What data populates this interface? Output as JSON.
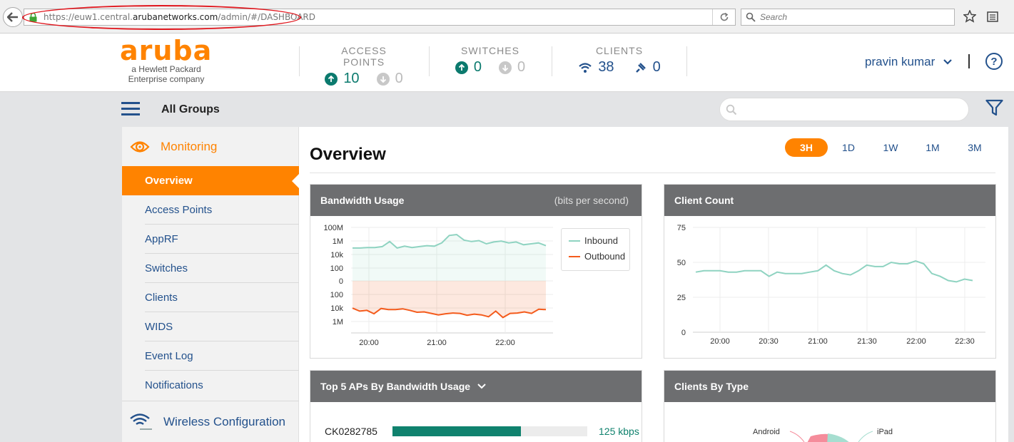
{
  "browser": {
    "url_prefix": "https://euw1.central.",
    "url_domain": "arubanetworks.com",
    "url_path": "/admin/#/DASHBOARD",
    "search_placeholder": "Search"
  },
  "header": {
    "logo_text": "aruba",
    "logo_sub": "a Hewlett Packard Enterprise company",
    "stats": [
      {
        "label": "ACCESS POINTS",
        "up": "10",
        "down": "0"
      },
      {
        "label": "SWITCHES",
        "up": "0",
        "down": "0"
      },
      {
        "label": "CLIENTS",
        "wifi": "38",
        "wired": "0"
      }
    ],
    "user": "pravin kumar",
    "help": "?"
  },
  "groupbar": {
    "title": "All Groups"
  },
  "sidebar": {
    "section": "Monitoring",
    "items": [
      "Overview",
      "Access Points",
      "AppRF",
      "Switches",
      "Clients",
      "WIDS",
      "Event Log",
      "Notifications"
    ],
    "active": "Overview",
    "next_section": "Wireless Configuration"
  },
  "main": {
    "title": "Overview",
    "ranges": [
      "3H",
      "1D",
      "1W",
      "1M",
      "3M"
    ],
    "active_range": "3H",
    "cards": {
      "bandwidth": {
        "title": "Bandwidth Usage",
        "unit": "(bits per second)"
      },
      "clients": {
        "title": "Client Count"
      },
      "topaps": {
        "title": "Top 5 APs By Bandwidth Usage"
      },
      "bytype": {
        "title": "Clients By Type",
        "labels": [
          "Android",
          "iPad"
        ]
      }
    },
    "topaps": [
      {
        "name": "CK0282785",
        "value": "125 kbps",
        "fraction": 0.66
      }
    ]
  },
  "colors": {
    "accent": "#ff8300",
    "inbound": "#8fd3c1",
    "outbound": "#f45b1c",
    "nav": "#23518c",
    "teal": "#10826e"
  },
  "chart_data": [
    {
      "type": "area",
      "title": "Bandwidth Usage",
      "unit": "(bits per second)",
      "y_ticks_top": [
        "100M",
        "1M",
        "10k",
        "100",
        "0"
      ],
      "y_ticks_bottom": [
        "100",
        "10k",
        "1M"
      ],
      "x_ticks": [
        "20:00",
        "21:00",
        "22:00"
      ],
      "series": [
        {
          "name": "Inbound",
          "values": [
            0.71,
            0.71,
            0.72,
            0.72,
            0.74,
            0.85,
            0.71,
            0.75,
            0.72,
            0.74,
            0.76,
            0.75,
            0.82,
            0.98,
            1.0,
            0.88,
            0.85,
            0.87,
            0.8,
            0.84,
            0.86,
            0.82,
            0.84,
            0.78,
            0.8,
            0.82,
            0.76
          ]
        },
        {
          "name": "Outbound",
          "values": [
            0.72,
            0.8,
            0.78,
            0.87,
            0.73,
            0.76,
            0.76,
            0.74,
            0.78,
            0.83,
            0.82,
            0.86,
            0.9,
            0.87,
            0.85,
            0.86,
            0.91,
            0.88,
            0.9,
            0.95,
            0.8,
            0.97,
            0.86,
            0.85,
            0.82,
            0.86,
            0.75,
            0.76
          ]
        }
      ],
      "legend": "right"
    },
    {
      "type": "line",
      "title": "Client Count",
      "x_ticks": [
        "20:00",
        "20:30",
        "21:00",
        "21:30",
        "22:00",
        "22:30"
      ],
      "y_ticks": [
        "0",
        "25",
        "50",
        "75"
      ],
      "ylim": [
        0,
        75
      ],
      "series": [
        {
          "values": [
            43,
            44,
            44,
            44,
            43,
            43,
            44,
            44,
            44,
            40,
            43,
            42,
            42,
            42,
            43,
            44,
            48,
            44,
            42,
            41,
            44,
            48,
            47,
            47,
            50,
            49,
            49,
            51,
            49,
            42,
            40,
            37,
            36,
            38,
            37
          ]
        }
      ]
    }
  ]
}
